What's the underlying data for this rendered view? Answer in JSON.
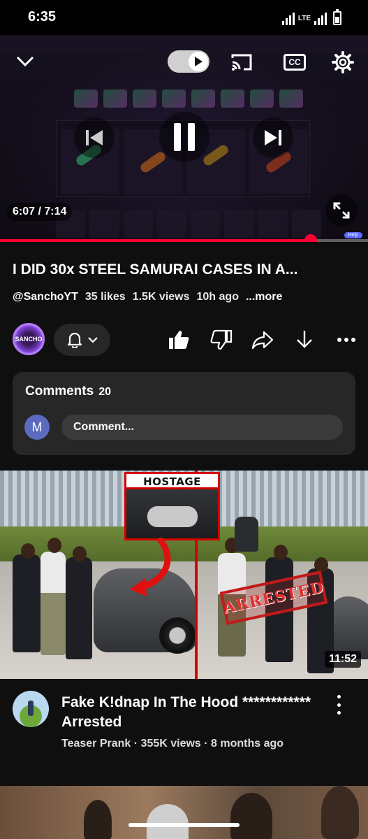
{
  "status_bar": {
    "time": "6:35",
    "network": "LTE"
  },
  "player": {
    "time_current": "6:07",
    "time_total": "7:14",
    "time_display": "6:07 / 7:14",
    "progress_fraction": 0.845,
    "captions_label": "CC",
    "help_label": "Help",
    "accent_color": "#ff0033"
  },
  "video": {
    "title": "I DID 30x STEEL SAMURAI CASES IN A...",
    "channel_handle": "@SanchoYT",
    "likes": "35 likes",
    "views": "1.5K views",
    "age": "10h ago",
    "more_label": "...more",
    "channel_avatar_text": "SANCHO"
  },
  "comments": {
    "title": "Comments",
    "count": "20",
    "user_initial": "M",
    "placeholder": "Comment..."
  },
  "next_video": {
    "title": "Fake K!dnap In The Hood ************ Arrested",
    "meta": "Teaser Prank · 355K views · 8 months ago",
    "duration": "11:52",
    "overlay_hostage": "HOSTAGE",
    "overlay_arrested": "ARRESTED"
  }
}
